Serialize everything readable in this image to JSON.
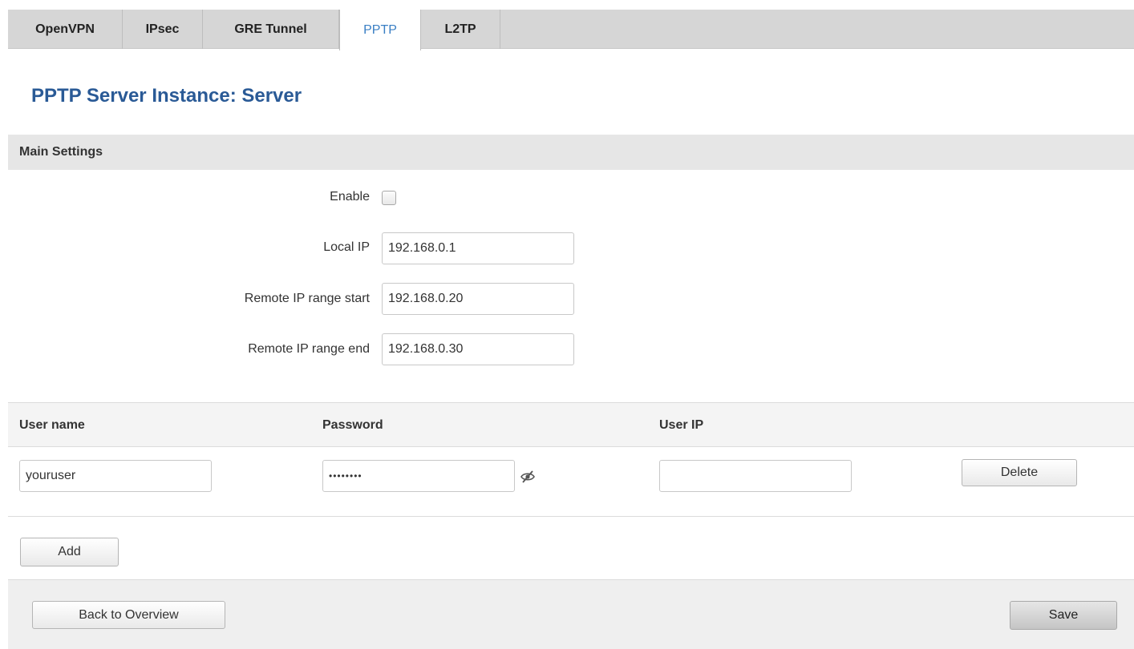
{
  "tabs": [
    {
      "label": "OpenVPN"
    },
    {
      "label": "IPsec"
    },
    {
      "label": "GRE Tunnel"
    },
    {
      "label": "PPTP",
      "active": true
    },
    {
      "label": "L2TP"
    }
  ],
  "page_title": "PPTP Server Instance: Server",
  "main_settings": {
    "heading": "Main Settings",
    "enable_label": "Enable",
    "enable_checked": false,
    "local_ip_label": "Local IP",
    "local_ip_value": "192.168.0.1",
    "remote_start_label": "Remote IP range start",
    "remote_start_value": "192.168.0.20",
    "remote_end_label": "Remote IP range end",
    "remote_end_value": "192.168.0.30"
  },
  "users_table": {
    "columns": [
      "User name",
      "Password",
      "User IP"
    ],
    "rows": [
      {
        "username": "youruser",
        "password": "••••••••",
        "user_ip": "",
        "delete_label": "Delete"
      }
    ],
    "add_label": "Add"
  },
  "footer": {
    "back_label": "Back to Overview",
    "save_label": "Save"
  },
  "icons": {
    "password_toggle": "eye-slash-icon"
  },
  "colors": {
    "accent": "#3a7fc4",
    "title": "#2a5a96"
  }
}
